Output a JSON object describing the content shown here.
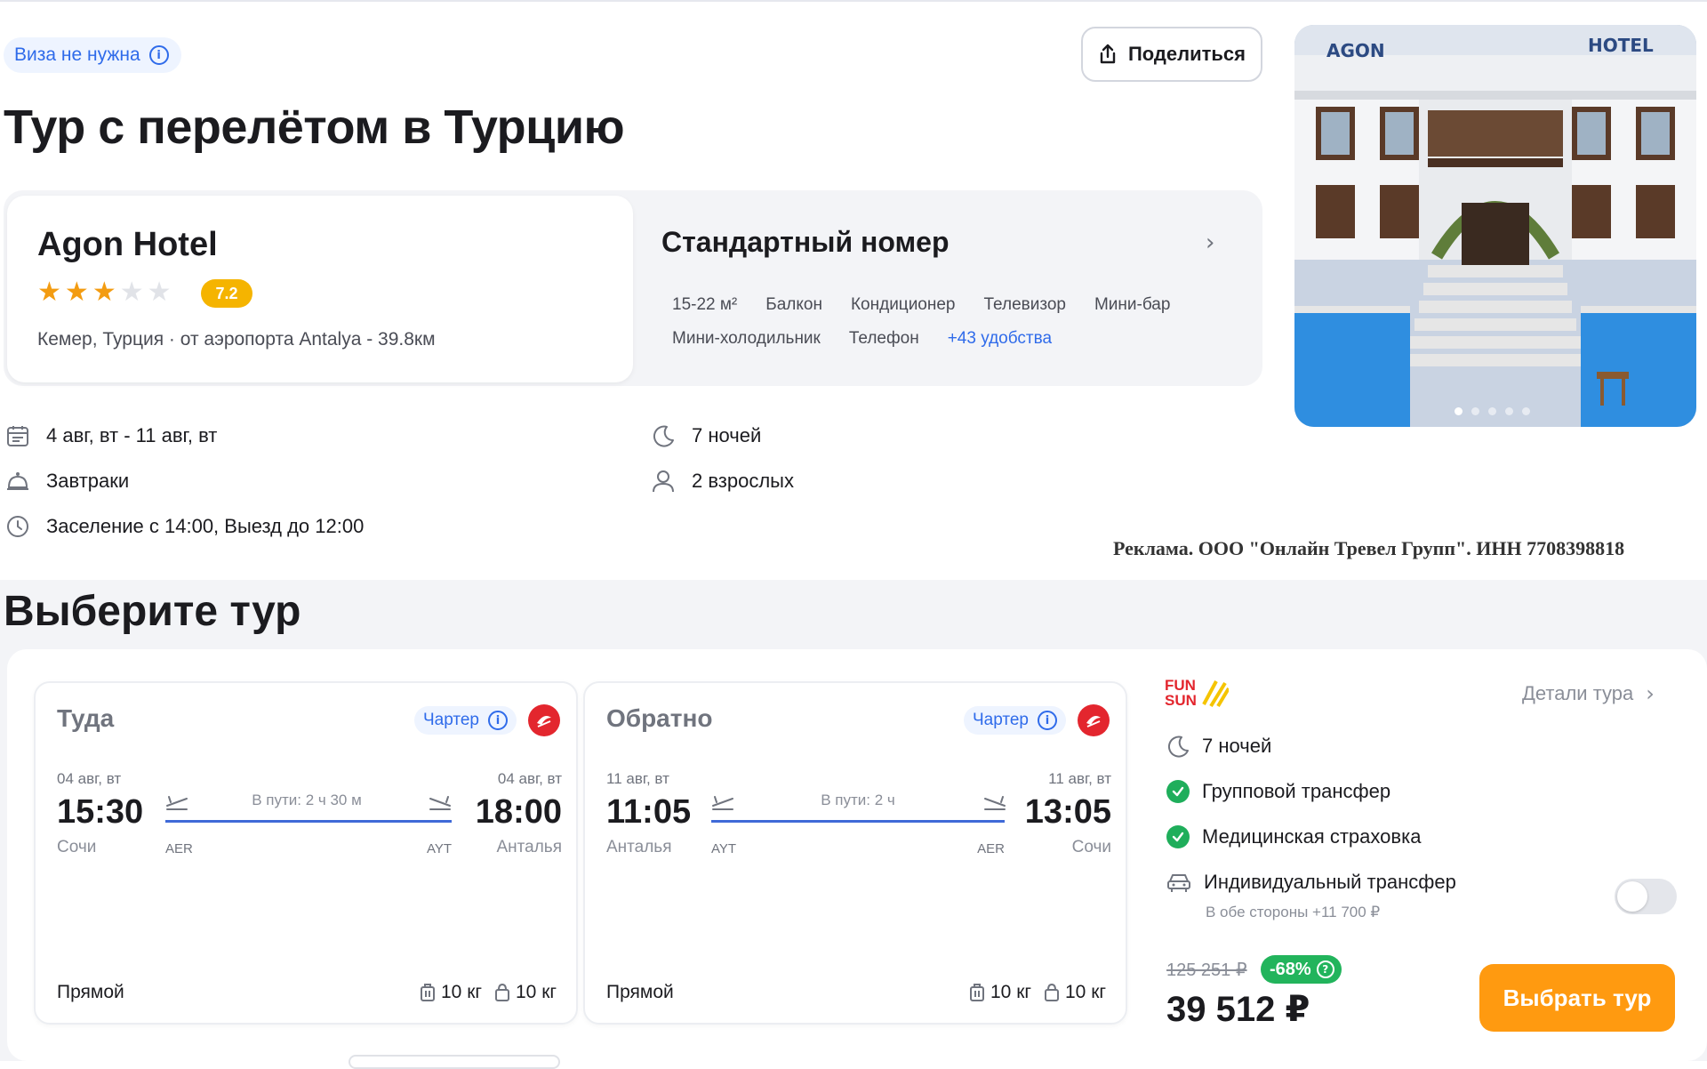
{
  "header": {
    "visa_label": "Виза не нужна",
    "share_label": "Поделиться",
    "page_title": "Тур с перелётом в Турцию"
  },
  "hotel": {
    "name": "Agon Hotel",
    "stars": 3,
    "stars_max": 5,
    "rating": "7.2",
    "location": "Кемер, Турция · от аэропорта Antalya - 39.8км",
    "photo_sign_left": "AGON",
    "photo_sign_right": "HOTEL",
    "photo_pages": 5
  },
  "room": {
    "title": "Стандартный номер",
    "amenities_row1": [
      "15-22 м²",
      "Балкон",
      "Кондиционер",
      "Телевизор",
      "Мини-бар"
    ],
    "amenities_row2": [
      "Мини-холодильник",
      "Телефон"
    ],
    "more_label": "+43 удобства"
  },
  "trip_info": {
    "dates": "4 авг, вт - 11 авг, вт",
    "meals": "Завтраки",
    "checkin": "Заселение с 14:00, Выезд до 12:00",
    "nights": "7 ночей",
    "guests": "2 взрослых"
  },
  "ad_note": "Реклама. ООО \"Онлайн Тревел Групп\". ИНН 7708398818",
  "tour": {
    "section_title": "Выберите тур",
    "outbound": {
      "direction": "Туда",
      "charter_label": "Чартер",
      "dep_date": "04 авг, вт",
      "dep_time": "15:30",
      "dep_city": "Сочи",
      "dep_code": "AER",
      "duration": "В пути: 2 ч 30 м",
      "arr_date": "04 авг, вт",
      "arr_time": "18:00",
      "arr_city": "Анталья",
      "arr_code": "AYT",
      "type": "Прямой",
      "hand_bag": "10 кг",
      "baggage": "10 кг"
    },
    "return": {
      "direction": "Обратно",
      "charter_label": "Чартер",
      "dep_date": "11 авг, вт",
      "dep_time": "11:05",
      "dep_city": "Анталья",
      "dep_code": "AYT",
      "duration": "В пути: 2 ч",
      "arr_date": "11 авг, вт",
      "arr_time": "13:05",
      "arr_city": "Сочи",
      "arr_code": "AER",
      "type": "Прямой",
      "hand_bag": "10 кг",
      "baggage": "10 кг"
    },
    "operator_logo_line1": "FUN",
    "operator_logo_line2": "SUN",
    "details_label": "Детали тура",
    "nights": "7 ночей",
    "included": [
      "Групповой трансфер",
      "Медицинская страховка"
    ],
    "transfer_label": "Индивидуальный трансфер",
    "transfer_sub": "В обе стороны +11 700 ₽",
    "transfer_enabled": false,
    "old_price": "125 251 ₽",
    "discount": "-68%",
    "price": "39 512 ₽",
    "choose_label": "Выбрать тур"
  },
  "colors": {
    "accent_blue": "#2f6bea",
    "accent_orange": "#ff9a10",
    "rating_yellow": "#f5b400",
    "success_green": "#1fae5b",
    "airline_red": "#e3262e"
  }
}
